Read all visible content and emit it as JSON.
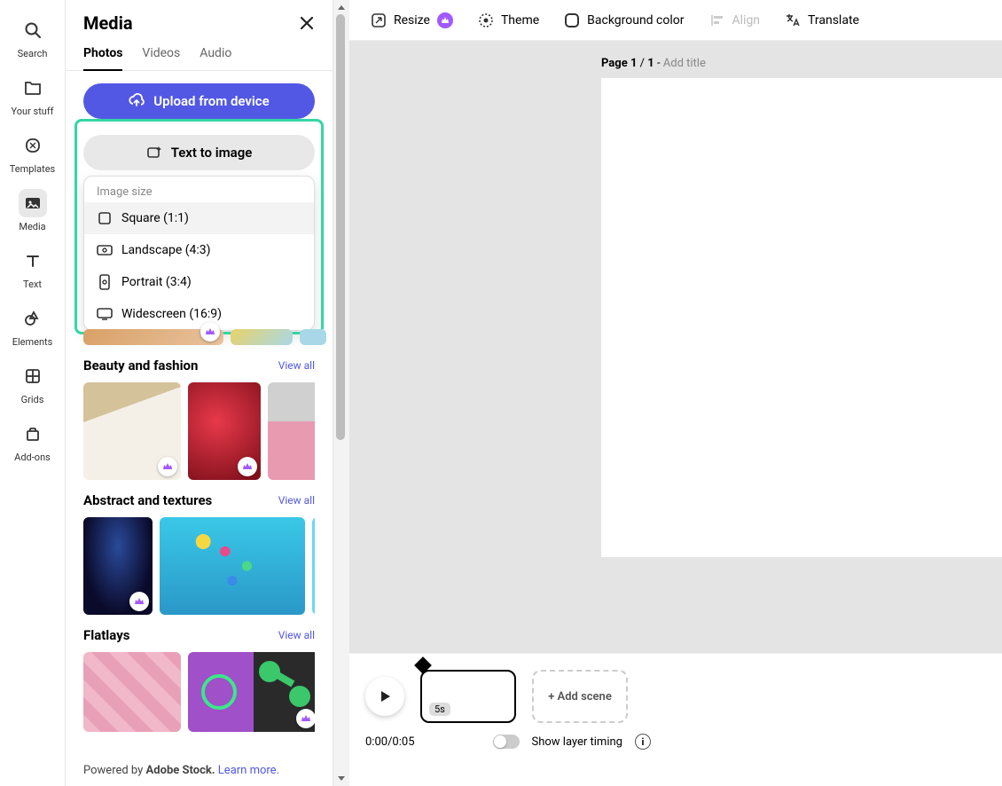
{
  "nav": {
    "items": [
      {
        "label": "Search",
        "icon": "search-icon"
      },
      {
        "label": "Your stuff",
        "icon": "folder-icon"
      },
      {
        "label": "Templates",
        "icon": "template-icon"
      },
      {
        "label": "Media",
        "icon": "media-icon"
      },
      {
        "label": "Text",
        "icon": "text-icon"
      },
      {
        "label": "Elements",
        "icon": "elements-icon"
      },
      {
        "label": "Grids",
        "icon": "grids-icon"
      },
      {
        "label": "Add-ons",
        "icon": "addons-icon"
      }
    ],
    "active_index": 3
  },
  "panel": {
    "title": "Media",
    "tabs": [
      {
        "label": "Photos"
      },
      {
        "label": "Videos"
      },
      {
        "label": "Audio"
      }
    ],
    "active_tab": 0,
    "upload_label": "Upload from device",
    "tti_label": "Text to image",
    "dropdown": {
      "heading": "Image size",
      "options": [
        {
          "label": "Square (1:1)",
          "icon": "square-icon"
        },
        {
          "label": "Landscape (4:3)",
          "icon": "landscape-icon"
        },
        {
          "label": "Portrait (3:4)",
          "icon": "portrait-icon"
        },
        {
          "label": "Widescreen (16:9)",
          "icon": "widescreen-icon"
        }
      ],
      "hover_index": 0
    },
    "categories": [
      {
        "title": "Beauty and fashion",
        "viewall": "View all"
      },
      {
        "title": "Abstract and textures",
        "viewall": "View all"
      },
      {
        "title": "Flatlays",
        "viewall": "View all"
      }
    ],
    "footer_prefix": "Powered by ",
    "footer_brand": "Adobe Stock.",
    "footer_link": "Learn more."
  },
  "toolbar": {
    "resize": "Resize",
    "theme": "Theme",
    "bgcolor": "Background color",
    "align": "Align",
    "translate": "Translate"
  },
  "stage": {
    "page_prefix": "Page ",
    "page_current": "1",
    "page_sep": " / ",
    "page_total": "1",
    "page_dash": " - ",
    "add_title": "Add title"
  },
  "timeline": {
    "scene_duration": "5s",
    "add_scene": "+ Add scene",
    "time": "0:00/0:05",
    "layer_label": "Show layer timing"
  }
}
